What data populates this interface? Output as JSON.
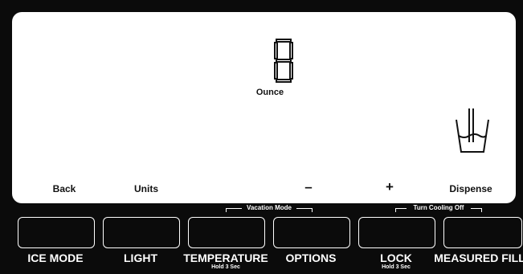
{
  "display": {
    "digit": "8",
    "unit": "Ounce",
    "dispense_icon": "cup-with-dispenser-icon"
  },
  "screen_labels": {
    "back": "Back",
    "units": "Units",
    "minus": "–",
    "plus": "+",
    "dispense": "Dispense"
  },
  "brackets": {
    "vacation": "Vacation Mode",
    "cooling": "Turn Cooling Off"
  },
  "buttons": [
    {
      "label": "ICE MODE",
      "sub": ""
    },
    {
      "label": "LIGHT",
      "sub": ""
    },
    {
      "label": "TEMPERATURE",
      "sub": "Hold 3 Sec"
    },
    {
      "label": "OPTIONS",
      "sub": ""
    },
    {
      "label": "LOCK",
      "sub": "Hold 3 Sec"
    },
    {
      "label": "MEASURED FILL",
      "sub": ""
    }
  ],
  "colors": {
    "panel": "#0b0b0b",
    "screen": "#ffffff",
    "ink": "#111111"
  }
}
